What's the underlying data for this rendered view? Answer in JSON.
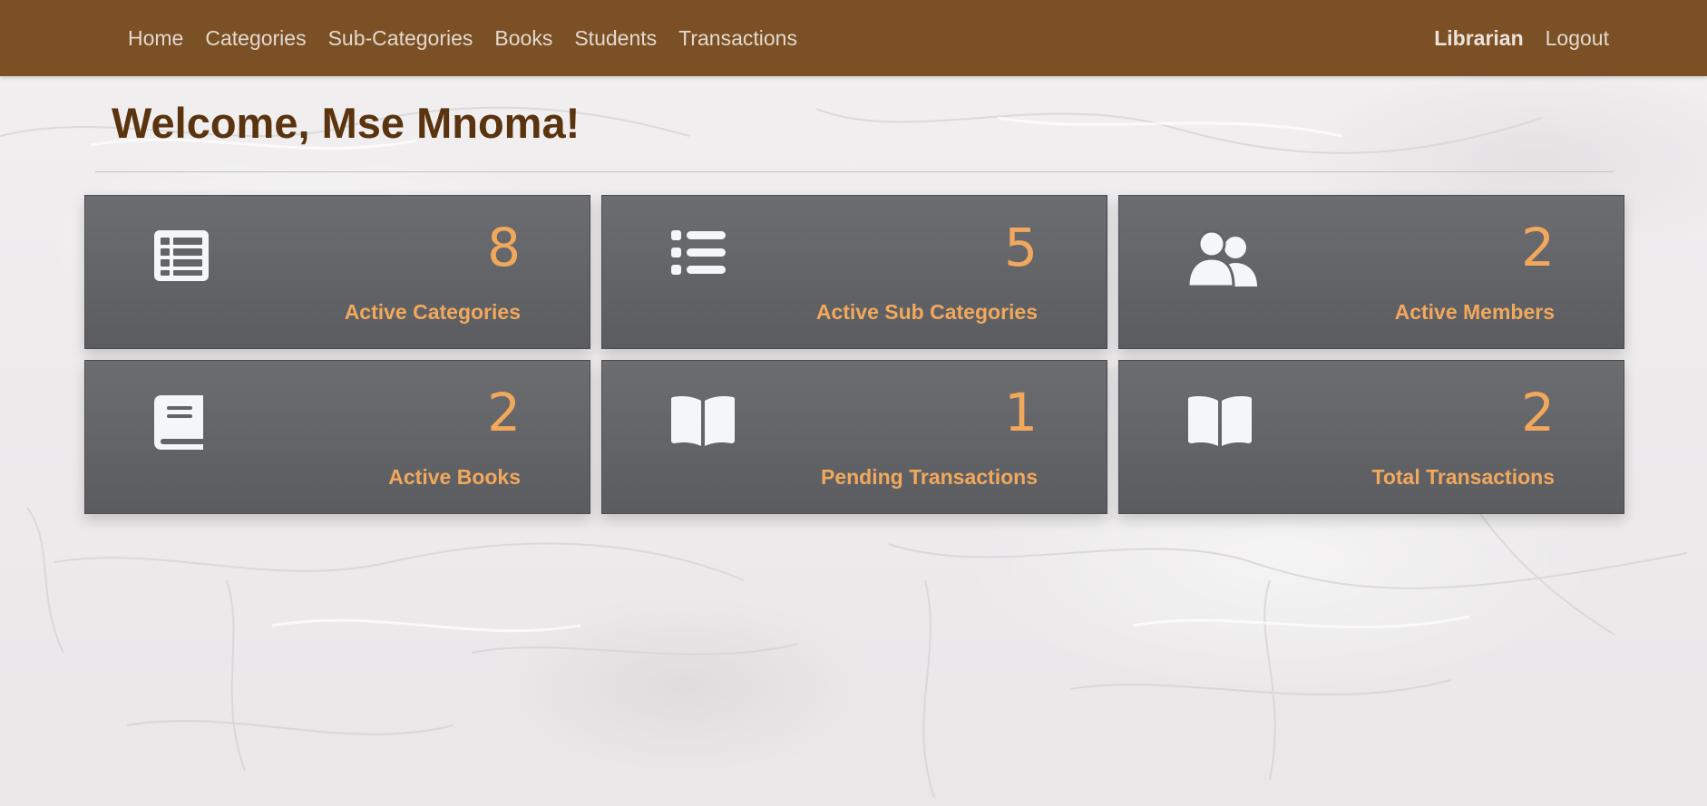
{
  "nav": {
    "left": [
      "Home",
      "Categories",
      "Sub-Categories",
      "Books",
      "Students",
      "Transactions"
    ],
    "user": "Librarian",
    "logout": "Logout",
    "bar_color": "#7b5024",
    "link_color": "#e3d9cf"
  },
  "main": {
    "welcome": "Welcome, Mse Mnoma!",
    "welcome_color": "#5a330f"
  },
  "cards": [
    {
      "value": "8",
      "label": "Active Categories",
      "icon": "table-list-icon"
    },
    {
      "value": "5",
      "label": "Active Sub Categories",
      "icon": "list-icon"
    },
    {
      "value": "2",
      "label": "Active Members",
      "icon": "users-icon"
    },
    {
      "value": "2",
      "label": "Active Books",
      "icon": "book-icon"
    },
    {
      "value": "1",
      "label": "Pending Transactions",
      "icon": "open-book-icon"
    },
    {
      "value": "2",
      "label": "Total Transactions",
      "icon": "open-book-icon"
    }
  ],
  "theme": {
    "accent": "#f2a85c",
    "card_bg": "#626467",
    "icon_color": "#f4f6fa"
  }
}
